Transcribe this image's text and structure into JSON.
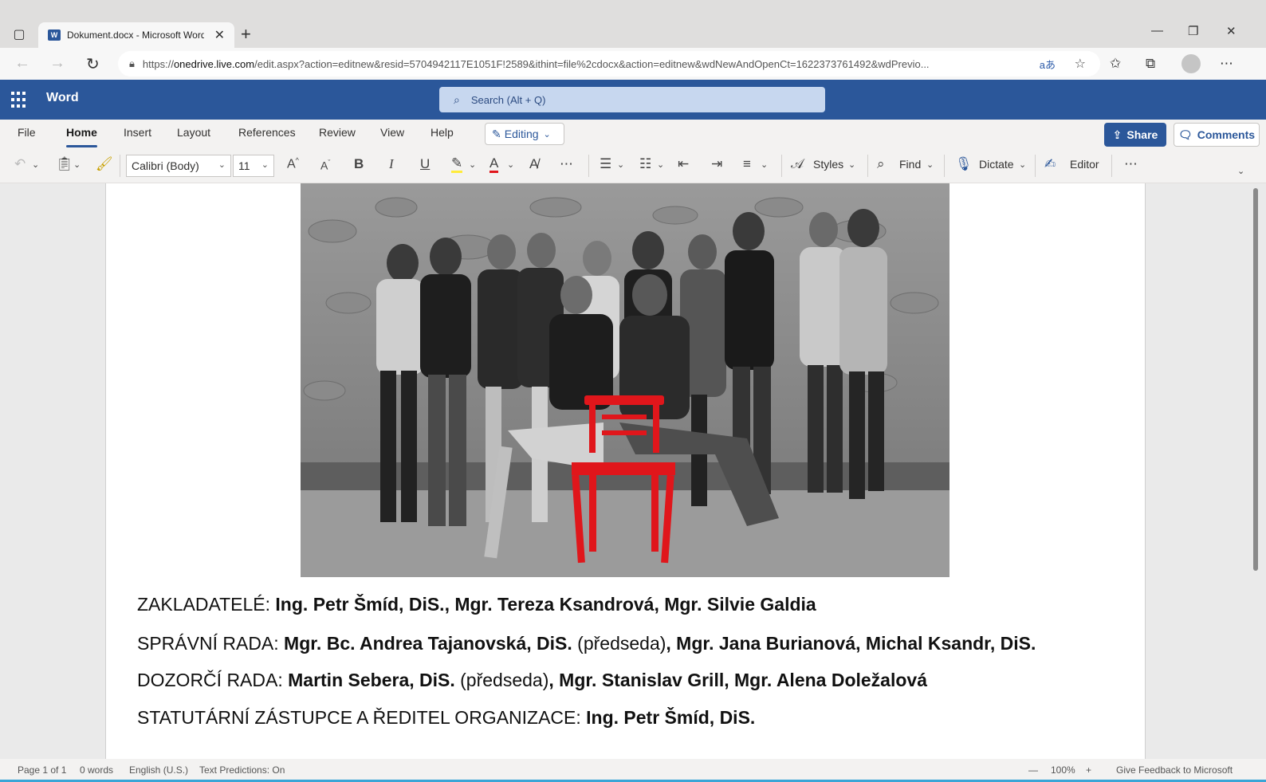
{
  "browser": {
    "tab_title": "Dokument.docx - Microsoft Word",
    "url_prefix": "https://",
    "url_domain": "onedrive.live.com",
    "url_rest": "/edit.aspx?action=editnew&resid=5704942117E1051F!2589&ithint=file%2cdocx&action=editnew&wdNewAndOpenCt=1622373761492&wdPrevio...",
    "read_aloud": "aあ"
  },
  "app": {
    "name": "Word",
    "search_placeholder": "Search (Alt + Q)"
  },
  "ribbon": {
    "tabs": [
      "File",
      "Home",
      "Insert",
      "Layout",
      "References",
      "Review",
      "View",
      "Help"
    ],
    "editing_label": "Editing",
    "share_label": "Share",
    "comments_label": "Comments"
  },
  "toolbar": {
    "font": "Calibri (Body)",
    "size": "11",
    "styles_label": "Styles",
    "find_label": "Find",
    "dictate_label": "Dictate",
    "editor_label": "Editor"
  },
  "document": {
    "lines": [
      {
        "label": "ZAKLADATELÉ: ",
        "bold1": "Ing. Petr Šmíd, DiS., Mgr. Tereza Ksandrová, Mgr. Silvie Galdia",
        "normal": "",
        "bold2": ""
      },
      {
        "label": "SPRÁVNÍ RADA: ",
        "bold1": "Mgr. Bc. Andrea Tajanovská, DiS.",
        "normal": " (předseda)",
        "bold2": ", Mgr. Jana Burianová, Michal Ksandr, DiS."
      },
      {
        "label": "DOZORČÍ RADA: ",
        "bold1": "Martin Sebera, DiS.",
        "normal": " (předseda)",
        "bold2": ", Mgr. Stanislav Grill, Mgr. Alena Doležalová"
      },
      {
        "label": "STATUTÁRNÍ ZÁSTUPCE A ŘEDITEL ORGANIZACE: ",
        "bold1": "Ing. Petr Šmíd, DiS.",
        "normal": "",
        "bold2": ""
      }
    ]
  },
  "status": {
    "page": "Page 1 of 1",
    "words": "0 words",
    "language": "English (U.S.)",
    "predictions": "Text Predictions: On",
    "zoom": "100%",
    "feedback": "Give Feedback to Microsoft"
  },
  "colors": {
    "word_blue": "#2b579a",
    "chair_red": "#e0161b"
  }
}
